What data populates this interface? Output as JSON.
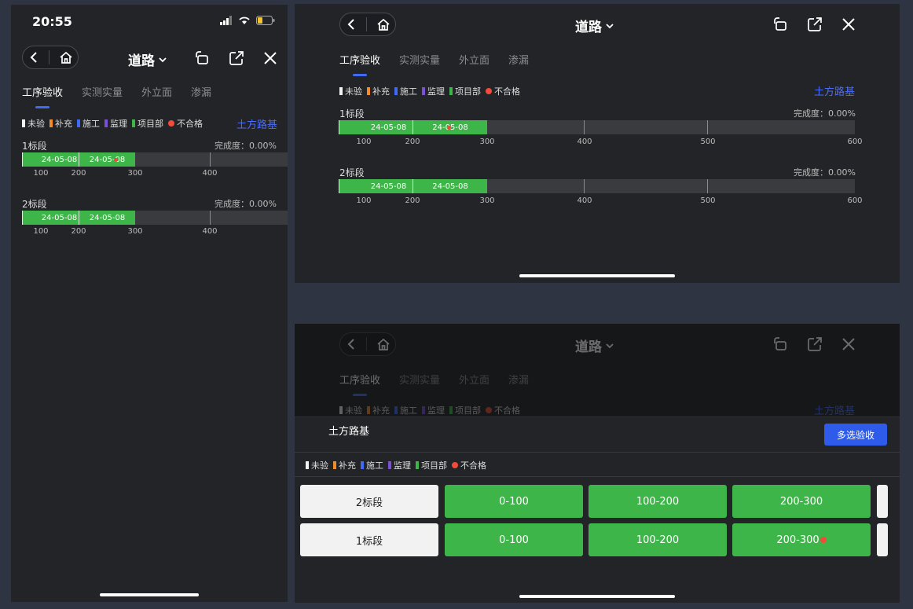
{
  "phone": {
    "time": "20:55",
    "nav": {
      "title": "道路"
    },
    "tabs": [
      "工序验收",
      "实测实量",
      "外立面",
      "渗漏"
    ],
    "legend": [
      {
        "label": "未验",
        "color": "#f2f2f2"
      },
      {
        "label": "补充",
        "color": "#f28c28"
      },
      {
        "label": "施工",
        "color": "#3f6af6"
      },
      {
        "label": "监理",
        "color": "#7b4fd6"
      },
      {
        "label": "项目部",
        "color": "#3eb549"
      },
      {
        "label": "不合格",
        "color": "#f24b3b"
      }
    ],
    "legend_link": "土方路基",
    "segments": [
      {
        "name": "1标段",
        "progress": "完成度：0.00%",
        "blocks": [
          "24-05-08",
          "24-05-08"
        ],
        "ticks": [
          "100",
          "200",
          "300",
          "400"
        ]
      },
      {
        "name": "2标段",
        "progress": "完成度：0.00%",
        "blocks": [
          "24-05-08",
          "24-05-08"
        ],
        "ticks": [
          "100",
          "200",
          "300",
          "400"
        ]
      }
    ]
  },
  "tablet": {
    "nav": {
      "title": "道路"
    },
    "tabs": [
      "工序验收",
      "实测实量",
      "外立面",
      "渗漏"
    ],
    "legend_link": "土方路基",
    "segments": [
      {
        "name": "1标段",
        "progress": "完成度：0.00%",
        "blocks": [
          "24-05-08",
          "24-05-08"
        ],
        "ticks": [
          "100",
          "200",
          "300",
          "400",
          "500",
          "600"
        ]
      },
      {
        "name": "2标段",
        "progress": "完成度：0.00%",
        "blocks": [
          "24-05-08",
          "24-05-08"
        ],
        "ticks": [
          "100",
          "200",
          "300",
          "400",
          "500",
          "600"
        ]
      }
    ]
  },
  "sheet": {
    "title": "土方路基",
    "multi_button": "多选验收",
    "rows": [
      {
        "label": "2标段",
        "cells": [
          "0-100",
          "100-200",
          "200-300"
        ]
      },
      {
        "label": "1标段",
        "cells": [
          "0-100",
          "100-200",
          "200-300"
        ]
      }
    ]
  },
  "colors": {
    "accent": "#3f6af6",
    "green": "#3eb549",
    "red": "#f24b3b",
    "link": "#4a6cf7"
  }
}
